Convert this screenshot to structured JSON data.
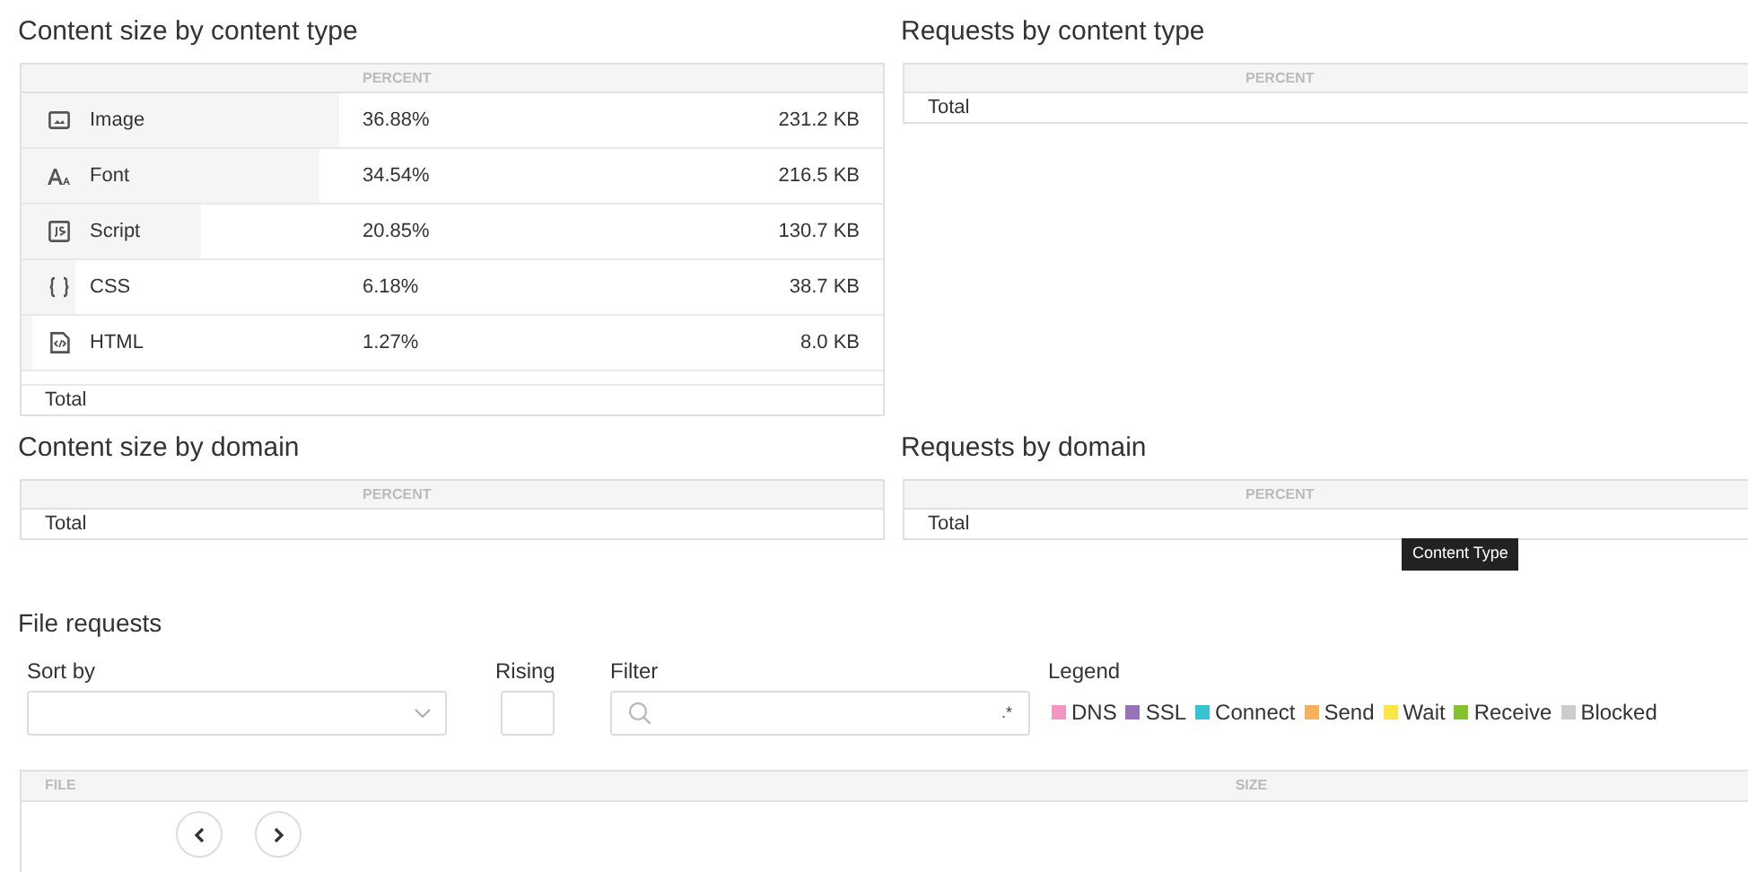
{
  "content_size_by_type": {
    "title": "Content size by content type",
    "header": "PERCENT",
    "rows": [
      {
        "kind": "image",
        "label": "Image",
        "percent": "36.88%",
        "size": "231.2 KB",
        "level": 0.3688
      },
      {
        "kind": "font",
        "label": "Font",
        "percent": "34.54%",
        "size": "216.5 KB",
        "level": 0.3454
      },
      {
        "kind": "script",
        "label": "Script",
        "percent": "20.85%",
        "size": "130.7 KB",
        "level": 0.2085
      },
      {
        "kind": "css",
        "label": "CSS",
        "percent": "6.18%",
        "size": "38.7 KB",
        "level": 0.0618
      },
      {
        "kind": "html",
        "label": "HTML",
        "percent": "1.27%",
        "size": "8.0 KB",
        "level": 0.0127
      }
    ],
    "total": "Total"
  },
  "requests_by_type": {
    "title": "Requests by content type",
    "header": "PERCENT",
    "total": "Total"
  },
  "content_size_by_domain": {
    "title": "Content size by domain",
    "header": "PERCENT",
    "total": "Total"
  },
  "requests_by_domain": {
    "title": "Requests by domain",
    "header": "PERCENT",
    "total": "Total"
  },
  "tooltip": "Content Type",
  "file_requests": {
    "title": "File requests",
    "sort_label": "Sort by",
    "rising_label": "Rising",
    "rising_checked": false,
    "filter_label": "Filter",
    "regex_mark": ".*",
    "legend_label": "Legend",
    "legend": [
      {
        "label": "DNS",
        "color": "#f497c0"
      },
      {
        "label": "SSL",
        "color": "#9b72b8"
      },
      {
        "label": "Connect",
        "color": "#37c3d2"
      },
      {
        "label": "Send",
        "color": "#f4b05a"
      },
      {
        "label": "Wait",
        "color": "#fde447"
      },
      {
        "label": "Receive",
        "color": "#85c232"
      },
      {
        "label": "Blocked",
        "color": "#cccccc"
      }
    ],
    "columns": [
      "FILE",
      "SIZE"
    ]
  }
}
